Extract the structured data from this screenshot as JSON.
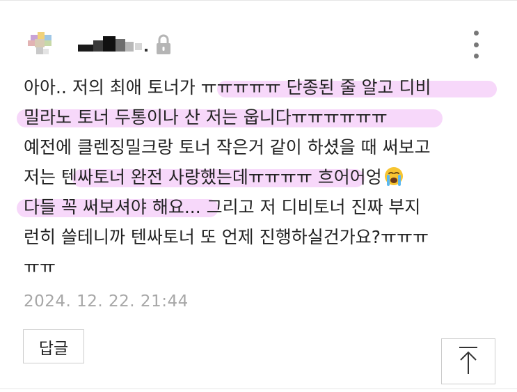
{
  "comment": {
    "author": {
      "avatar_icon": "blurred-avatar",
      "name_masked": true,
      "lock_icon": "lock-icon"
    },
    "more_icon": "more-vertical-icon",
    "lines": [
      "아아.. 저의 최애 토너가 ㅠㅠㅠㅠㅠ 단종된 줄 알고 디비",
      "밀라노 토너 두통이나 산 저는 웁니다ㅠㅠㅠㅠㅠㅠ",
      "예전에 클렌징밀크랑 토너 작은거 같이 하셨을 때 써보고",
      "저는 텐싸토너 완전 사랑했는데ㅠㅠㅠㅠ 흐어어엉",
      "다들 꼭 써보셔야 해요... 그리고 저 디비토너 진짜 부지",
      "런히 쓸테니까 텐싸토너 또 언제 진행하실건가요?ㅠㅠㅠ",
      "ㅠㅠ"
    ],
    "emoji_icon": "loudly-crying-face-icon",
    "highlight_color": "#eea8f5",
    "timestamp": "2024. 12. 22. 21:44",
    "reply_label": "답글",
    "scroll_top_icon": "arrow-up-icon"
  }
}
